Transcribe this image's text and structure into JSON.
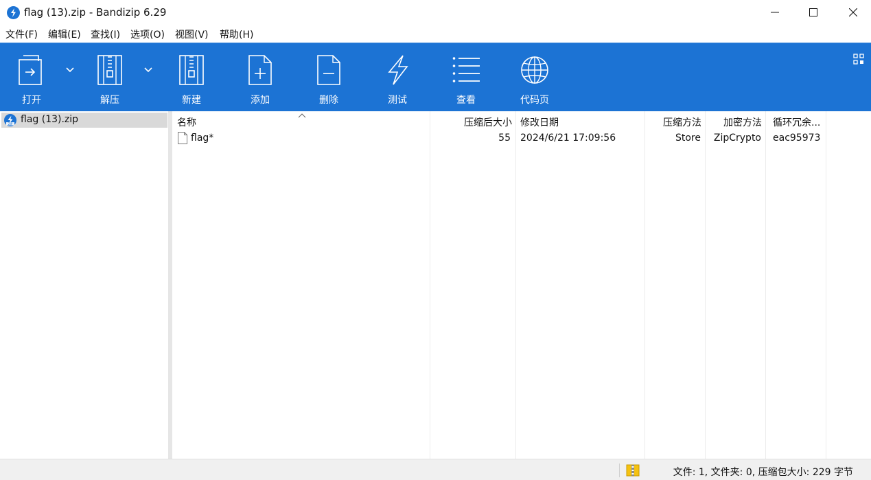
{
  "window": {
    "title": "flag (13).zip - Bandizip 6.29",
    "app_icon": "bandizip-logo-icon",
    "controls": [
      "minimize-icon",
      "maximize-icon",
      "close-icon"
    ]
  },
  "menu": [
    {
      "label": "文件(F)"
    },
    {
      "label": "编辑(E)"
    },
    {
      "label": "查找(I)"
    },
    {
      "label": "选项(O)"
    },
    {
      "label": "视图(V)"
    },
    {
      "label": "帮助(H)"
    }
  ],
  "toolbar": {
    "background": "#1c73d4",
    "buttons": [
      {
        "label": "打开",
        "icon": "open-archive-icon"
      },
      {
        "label": "解压",
        "icon": "extract-icon"
      },
      {
        "label": "新建",
        "icon": "new-archive-icon"
      },
      {
        "label": "添加",
        "icon": "add-file-icon"
      },
      {
        "label": "删除",
        "icon": "delete-file-icon"
      },
      {
        "label": "测试",
        "icon": "test-lightning-icon"
      },
      {
        "label": "查看",
        "icon": "view-list-icon"
      },
      {
        "label": "代码页",
        "icon": "codepage-globe-icon"
      }
    ]
  },
  "tree": {
    "items": [
      {
        "label": "flag (13).zip",
        "icon": "zip-archive-icon",
        "selected": true
      }
    ]
  },
  "file_list": {
    "columns": [
      "名称",
      "压缩后大小",
      "修改日期",
      "压缩方法",
      "加密方法",
      "循环冗余..."
    ],
    "sort_column": "名称",
    "rows": [
      {
        "name": "flag*",
        "compressed_size": "55",
        "modified": "2024/6/21 17:09:56",
        "method": "Store",
        "encryption": "ZipCrypto",
        "crc": "eac95973"
      }
    ]
  },
  "status": {
    "text": "文件: 1, 文件夹: 0, 压缩包大小: 229 字节",
    "icon": "archive-status-icon"
  }
}
